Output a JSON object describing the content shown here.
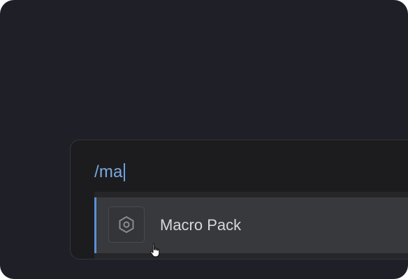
{
  "command_input": {
    "value": "/ma"
  },
  "results": [
    {
      "label": "Macro Pack",
      "icon": "hexagon-gear-icon",
      "selected": true
    }
  ],
  "colors": {
    "background": "#1f1f28",
    "palette": "#1c1c1f",
    "input_text": "#7aa9df",
    "accent": "#5b8fd8",
    "selected_row": "#38393c",
    "label_text": "#d8d8dc"
  }
}
